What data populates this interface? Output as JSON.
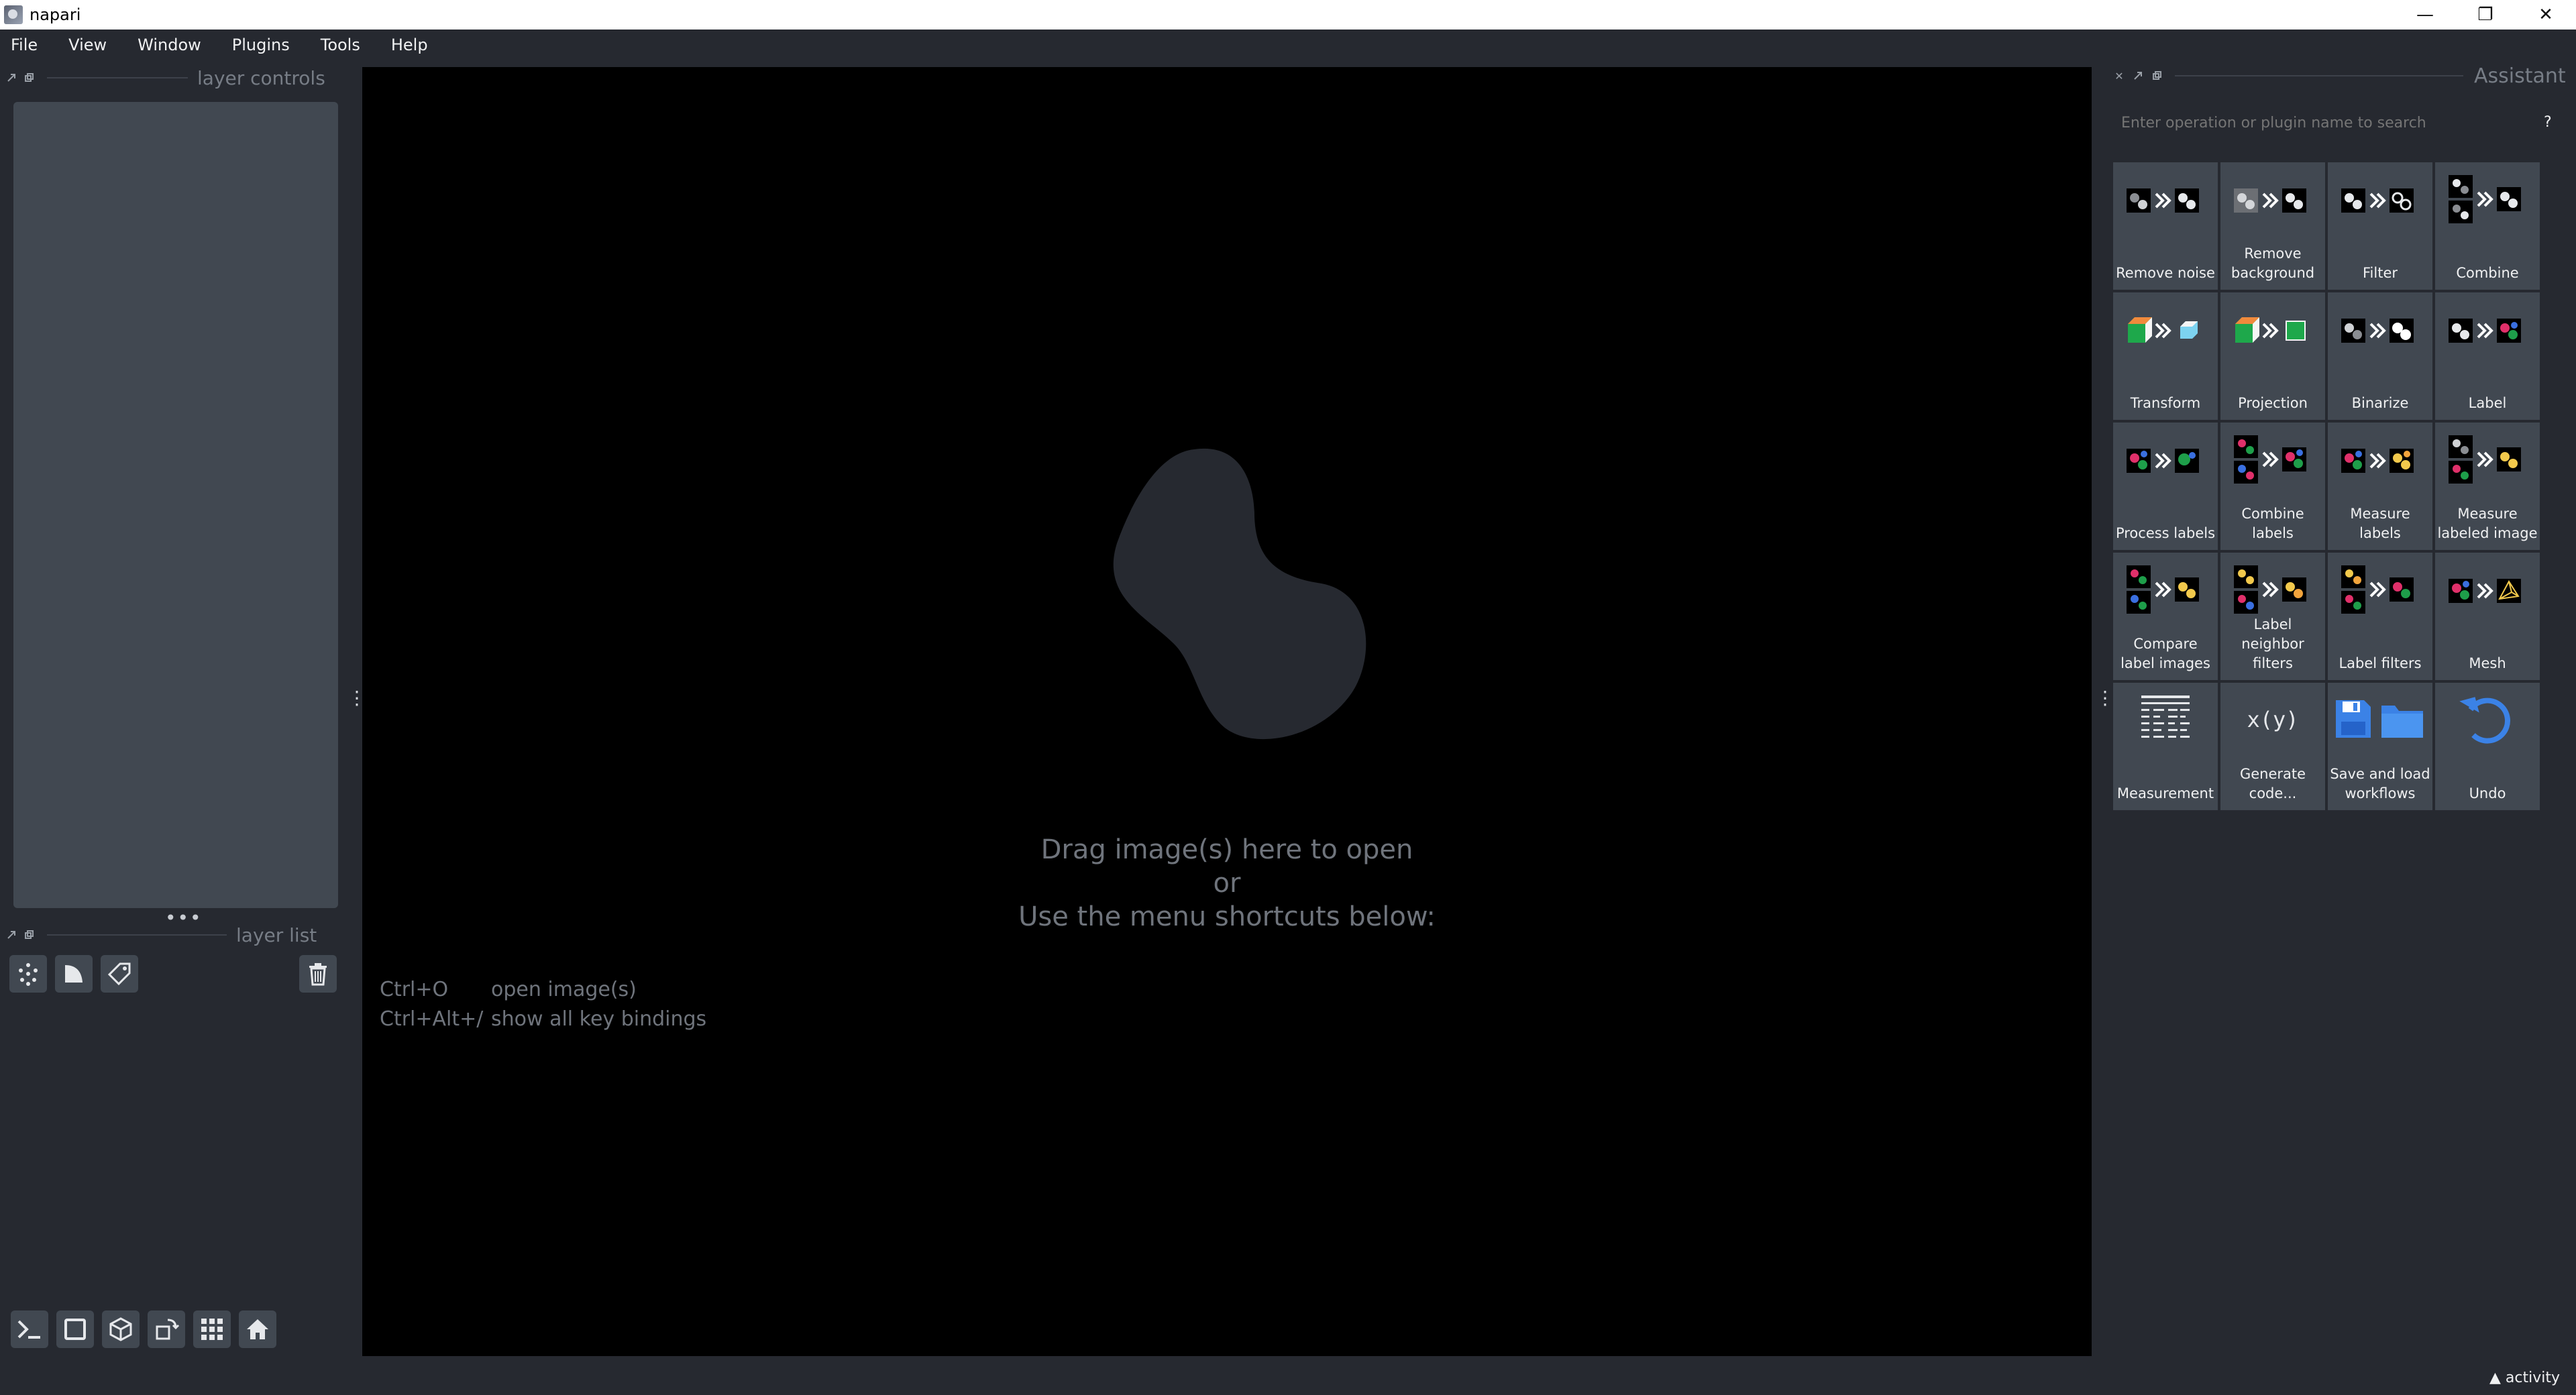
{
  "window": {
    "title": "napari",
    "minimize": "—",
    "restore": "❐",
    "close": "✕"
  },
  "menu": [
    "File",
    "View",
    "Window",
    "Plugins",
    "Tools",
    "Help"
  ],
  "left_dock": {
    "layer_controls_label": "layer controls",
    "layer_list_label": "layer list",
    "splitter": "•••",
    "handle": "⋮"
  },
  "canvas": {
    "welcome_lines": [
      "Drag image(s) here to open",
      "or",
      "Use the menu shortcuts below:"
    ],
    "shortcuts": [
      {
        "key": "Ctrl+O",
        "action": "open image(s)"
      },
      {
        "key": "Ctrl+Alt+/",
        "action": "show all key bindings"
      }
    ]
  },
  "assistant": {
    "title": "Assistant",
    "search_placeholder": "Enter operation or plugin name to search",
    "help": "?",
    "tiles": [
      {
        "label": "Remove noise",
        "icon": "remove-noise-icon"
      },
      {
        "label": "Remove background",
        "icon": "remove-background-icon"
      },
      {
        "label": "Filter",
        "icon": "filter-icon"
      },
      {
        "label": "Combine",
        "icon": "combine-icon"
      },
      {
        "label": "Transform",
        "icon": "transform-icon"
      },
      {
        "label": "Projection",
        "icon": "projection-icon"
      },
      {
        "label": "Binarize",
        "icon": "binarize-icon"
      },
      {
        "label": "Label",
        "icon": "label-icon"
      },
      {
        "label": "Process labels",
        "icon": "process-labels-icon"
      },
      {
        "label": "Combine labels",
        "icon": "combine-labels-icon"
      },
      {
        "label": "Measure labels",
        "icon": "measure-labels-icon"
      },
      {
        "label": "Measure labeled image",
        "icon": "measure-labeled-image-icon"
      },
      {
        "label": "Compare label images",
        "icon": "compare-label-images-icon"
      },
      {
        "label": "Label neighbor filters",
        "icon": "label-neighbor-filters-icon"
      },
      {
        "label": "Label filters",
        "icon": "label-filters-icon"
      },
      {
        "label": "Mesh",
        "icon": "mesh-icon"
      },
      {
        "label": "Measurement",
        "icon": "measurement-icon"
      },
      {
        "label": "Generate code...",
        "icon": "generate-code-icon"
      },
      {
        "label": "Save and load workflows",
        "icon": "save-load-icon"
      },
      {
        "label": "Undo",
        "icon": "undo-icon"
      }
    ],
    "code_glyph": "x(y)"
  },
  "status": {
    "activity": "▲ activity"
  },
  "colors": {
    "bg": "#262930",
    "panel": "#414851",
    "canvas": "#000000",
    "accent_blue": "#3b82e6"
  }
}
